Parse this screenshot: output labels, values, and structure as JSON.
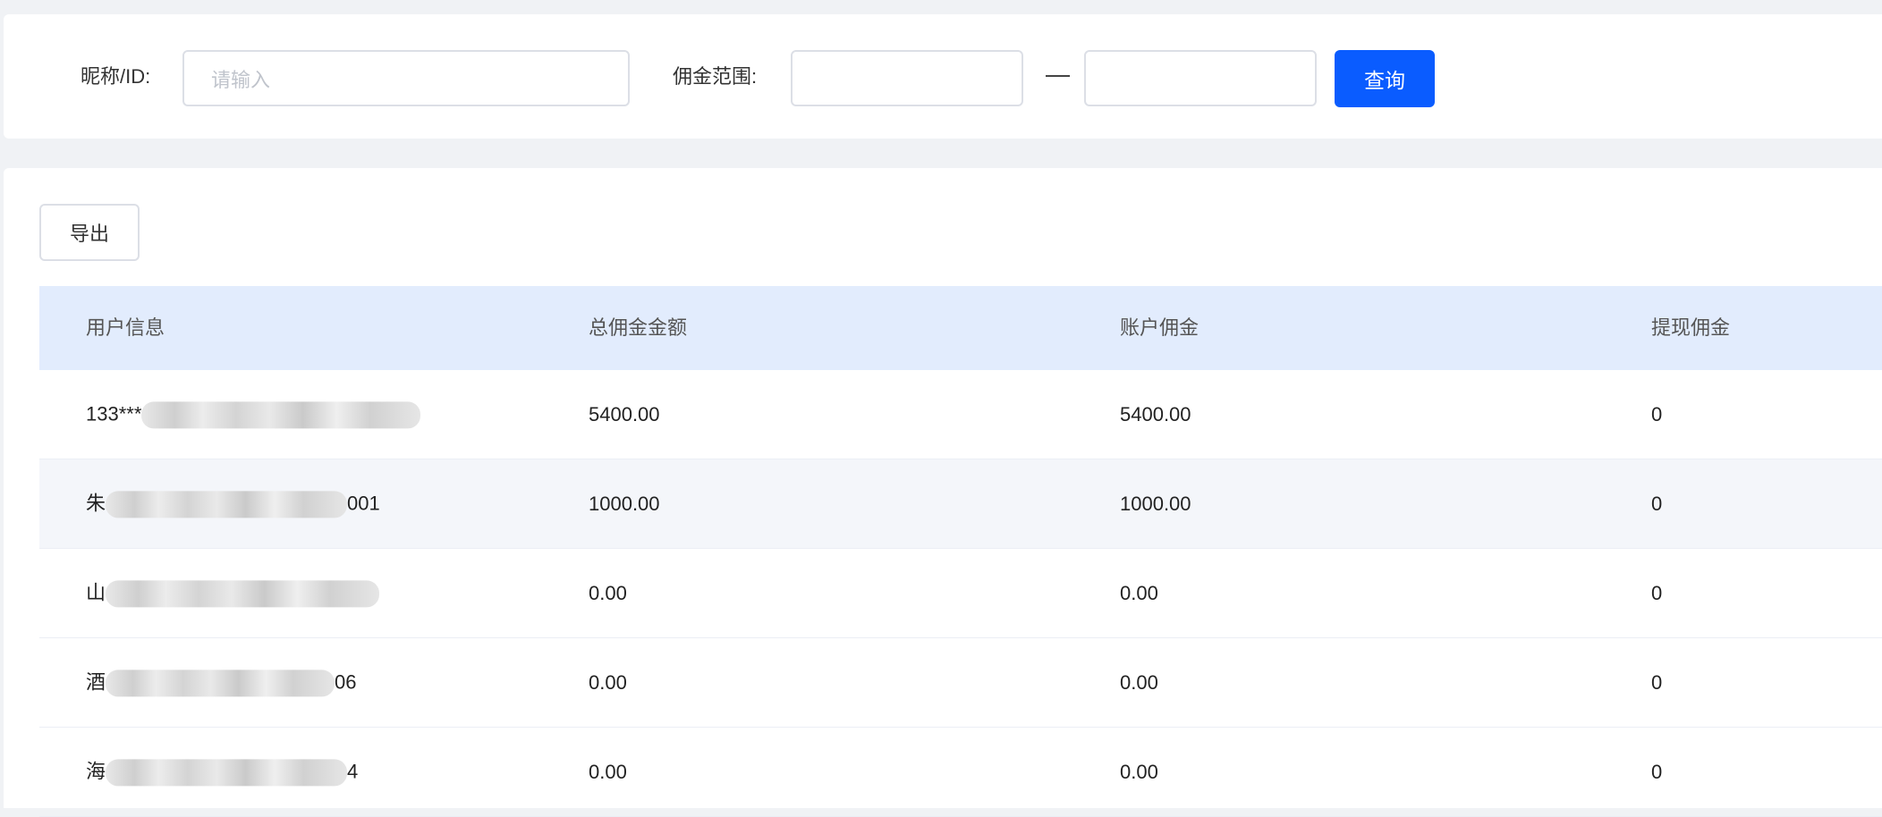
{
  "filter": {
    "nickname_label": "昵称/ID:",
    "nickname_placeholder": "请输入",
    "commission_label": "佣金范围:",
    "min_value": "",
    "max_value": "",
    "query_label": "查询"
  },
  "toolbar": {
    "export_label": "导出"
  },
  "table": {
    "headers": [
      "用户信息",
      "总佣金金额",
      "账户佣金",
      "提现佣金"
    ],
    "rows": [
      {
        "user_prefix": "133***",
        "user_suffix": "",
        "total": "5400.00",
        "account": "5400.00",
        "withdrawn": "0"
      },
      {
        "user_prefix": "朱",
        "user_suffix": "001",
        "total": "1000.00",
        "account": "1000.00",
        "withdrawn": "0"
      },
      {
        "user_prefix": "山",
        "user_suffix": "",
        "total": "0.00",
        "account": "0.00",
        "withdrawn": "0"
      },
      {
        "user_prefix": "酒",
        "user_suffix": "06",
        "total": "0.00",
        "account": "0.00",
        "withdrawn": "0"
      },
      {
        "user_prefix": "海",
        "user_suffix": "4",
        "total": "0.00",
        "account": "0.00",
        "withdrawn": "0"
      }
    ]
  },
  "colors": {
    "primary": "#0a5cff",
    "header_bg": "#e2ecfd",
    "stripe_bg": "#f4f6fa",
    "page_bg": "#f0f2f5"
  }
}
